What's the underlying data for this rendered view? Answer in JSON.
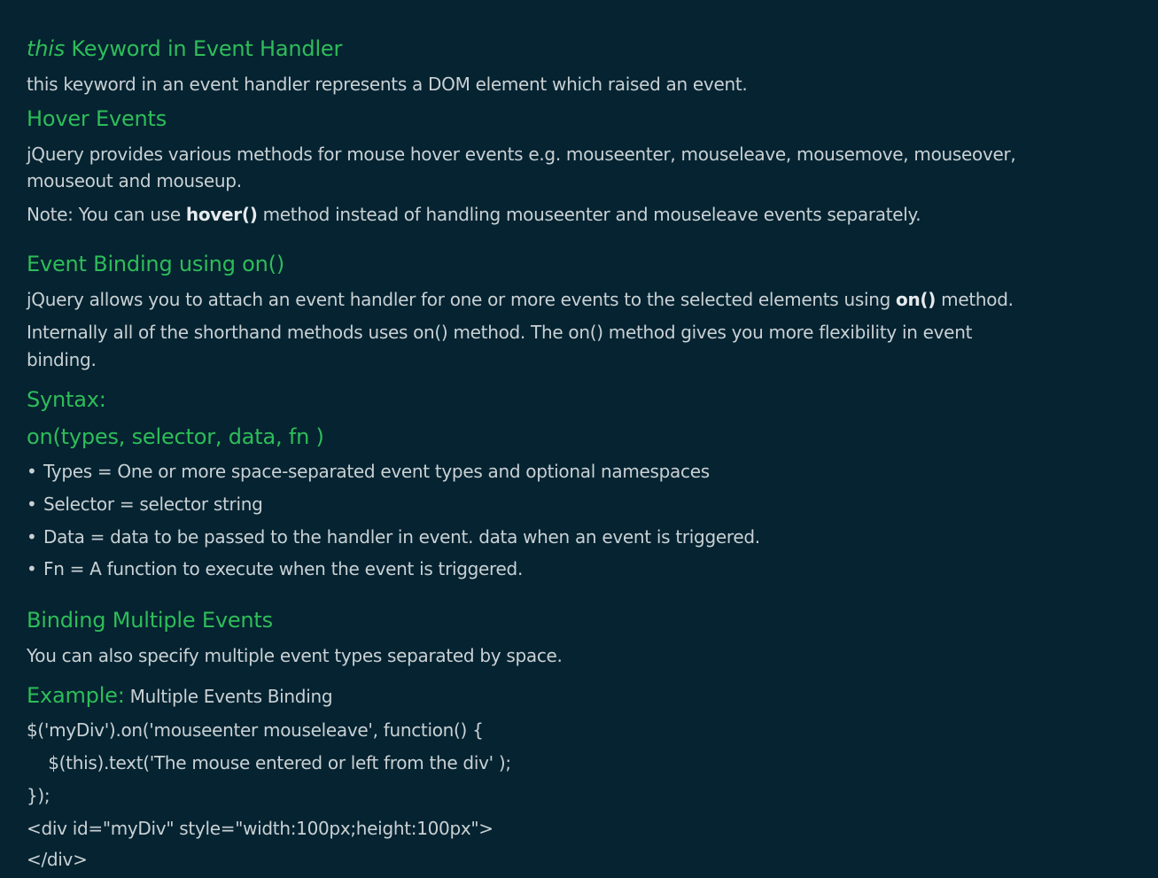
{
  "colors": {
    "background": "#052331",
    "heading": "#2ebd59",
    "text": "#c9d1d4"
  },
  "this_section": {
    "heading_em": "this",
    "heading_rest": " Keyword in Event Handler",
    "text": "this keyword in an event handler represents a DOM element which raised an event."
  },
  "hover_section": {
    "heading": "Hover Events",
    "text_line1": "jQuery provides various methods for mouse hover events e.g. mouseenter, mouseleave, mousemove, mouseover,",
    "text_line2": "mouseout and mouseup.",
    "note_prefix": "Note: You can use ",
    "note_bold": "hover()",
    "note_suffix": " method instead of handling mouseenter and mouseleave events separately."
  },
  "on_section": {
    "heading": "Event Binding using on()",
    "text1_prefix": "jQuery allows you to attach an event handler for one or more events to the selected elements using ",
    "text1_bold": "on()",
    "text1_suffix": " method.",
    "text2_line1": "Internally all of the shorthand methods uses on() method. The on() method gives you more flexibility in event",
    "text2_line2": "binding."
  },
  "syntax_section": {
    "heading": "Syntax:",
    "signature": "on(types, selector, data, fn )",
    "bullet_glyph": "•",
    "items": [
      "Types = One or more space-separated event types and optional namespaces",
      "Selector = selector string",
      "Data = data to be passed to the handler in event. data when an event is triggered.",
      "Fn = A function to execute when the event is triggered."
    ]
  },
  "multi_section": {
    "heading": "Binding Multiple Events",
    "text": "You can also specify multiple event types separated by space.",
    "example_label": "Example:",
    "example_title": " Multiple Events Binding",
    "code_lines": [
      "$('myDiv').on('mouseenter mouseleave', function() {",
      "    $(this).text('The mouse entered or left from the div' );",
      "});",
      "<div id=\"myDiv\" style=\"width:100px;height:100px\">",
      "</div>"
    ]
  }
}
